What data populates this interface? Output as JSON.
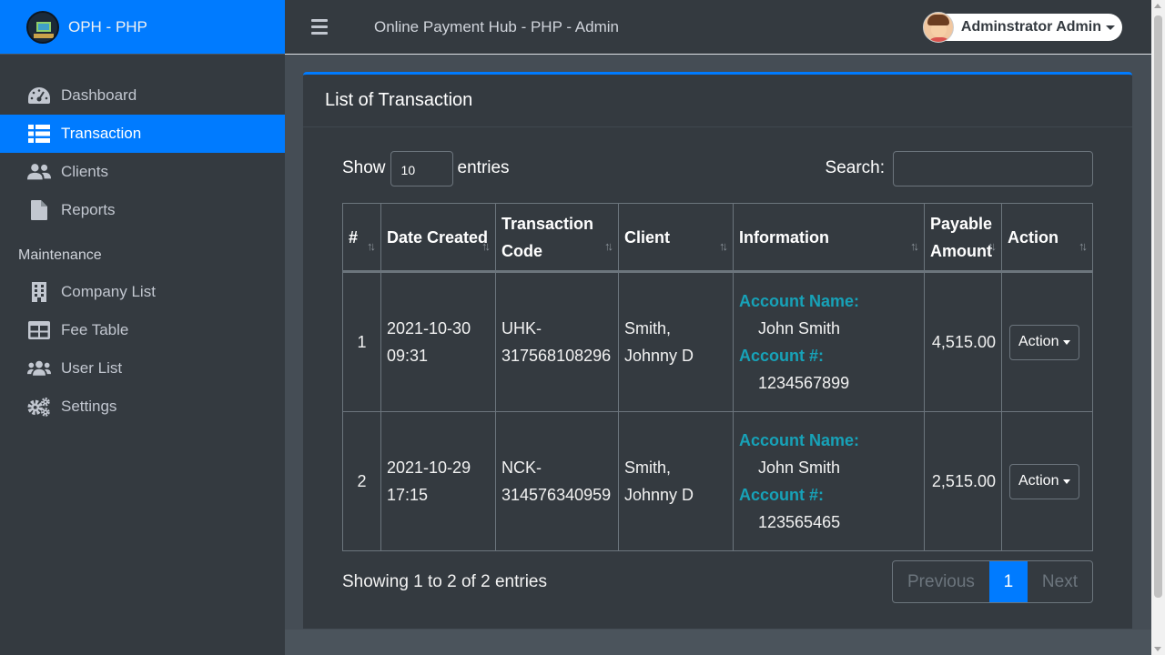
{
  "brand": {
    "name": "OPH - PHP"
  },
  "topbar": {
    "title": "Online Payment Hub - PHP - Admin",
    "user_name": "Adminstrator Admin"
  },
  "sidebar": {
    "items": [
      {
        "label": "Dashboard",
        "icon": "dashboard-icon"
      },
      {
        "label": "Transaction",
        "icon": "table-list-icon"
      },
      {
        "label": "Clients",
        "icon": "users-icon"
      },
      {
        "label": "Reports",
        "icon": "file-icon"
      }
    ],
    "section_header": "Maintenance",
    "maintenance": [
      {
        "label": "Company List",
        "icon": "building-icon"
      },
      {
        "label": "Fee Table",
        "icon": "table-icon"
      },
      {
        "label": "User List",
        "icon": "users-icon"
      },
      {
        "label": "Settings",
        "icon": "gears-icon"
      }
    ]
  },
  "card": {
    "title": "List of Transaction",
    "show_label": "Show",
    "length_value": "10",
    "entries_label": "entries",
    "search_label": "Search:",
    "search_value": "",
    "columns": [
      "#",
      "Date Created",
      "Transaction Code",
      "Client",
      "Information",
      "Payable Amount",
      "Action"
    ],
    "rows": [
      {
        "num": "1",
        "date": "2021-10-30",
        "time": "09:31",
        "code_prefix": "UHK-",
        "code_number": "317568108296",
        "client_last": "Smith,",
        "client_first": "Johnny D",
        "account_name_label": "Account Name:",
        "account_name": "John Smith",
        "account_num_label": "Account #:",
        "account_num": "1234567899",
        "amount": "4,515.00",
        "action_label": "Action"
      },
      {
        "num": "2",
        "date": "2021-10-29",
        "time": "17:15",
        "code_prefix": "NCK-",
        "code_number": "314576340959",
        "client_last": "Smith,",
        "client_first": "Johnny D",
        "account_name_label": "Account Name:",
        "account_name": "John Smith",
        "account_num_label": "Account #:",
        "account_num": "123565465",
        "amount": "2,515.00",
        "action_label": "Action"
      }
    ],
    "info_text": "Showing 1 to 2 of 2 entries",
    "pager": {
      "previous": "Previous",
      "current": "1",
      "next": "Next"
    }
  },
  "colors": {
    "accent": "#007bff",
    "sidebar": "#343a40",
    "info_label": "#17a2b8"
  }
}
